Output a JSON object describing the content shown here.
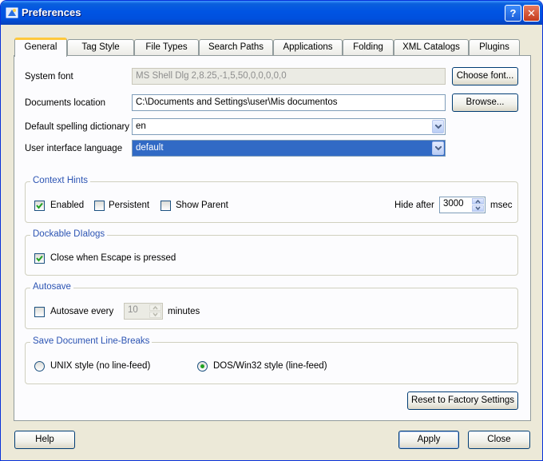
{
  "window": {
    "title": "Preferences",
    "help_glyph": "?",
    "close_glyph": "✕"
  },
  "tabs": [
    {
      "label": "General",
      "active": true
    },
    {
      "label": "Tag Style"
    },
    {
      "label": "File Types"
    },
    {
      "label": "Search Paths"
    },
    {
      "label": "Applications"
    },
    {
      "label": "Folding"
    },
    {
      "label": "XML Catalogs"
    },
    {
      "label": "Plugins"
    }
  ],
  "general": {
    "system_font_label": "System font",
    "system_font_value": "MS Shell Dlg 2,8.25,-1,5,50,0,0,0,0,0",
    "choose_font_label": "Choose font...",
    "documents_location_label": "Documents location",
    "documents_location_value": "C:\\Documents and Settings\\user\\Mis documentos",
    "browse_label": "Browse...",
    "spelling_label": "Default spelling dictionary",
    "spelling_value": "en",
    "ui_language_label": "User interface language",
    "ui_language_value": "default"
  },
  "context_hints": {
    "title": "Context Hints",
    "enabled_label": "Enabled",
    "enabled_checked": true,
    "persistent_label": "Persistent",
    "persistent_checked": false,
    "show_parent_label": "Show Parent",
    "show_parent_checked": false,
    "hide_after_label": "Hide after",
    "hide_after_value": "3000",
    "unit": "msec"
  },
  "dockable_dialogs": {
    "title": "Dockable DIalogs",
    "close_escape_label": "Close when Escape is pressed",
    "close_escape_checked": true
  },
  "autosave": {
    "title": "Autosave",
    "every_label": "Autosave every",
    "every_checked": false,
    "value": "10",
    "unit": "minutes"
  },
  "line_breaks": {
    "title": "Save Document Line-Breaks",
    "unix_label": "UNIX style (no line-feed)",
    "dos_label": "DOS/Win32 style (line-feed)",
    "selected": "dos"
  },
  "reset_label": "Reset to Factory Settings",
  "footer": {
    "help_label": "Help",
    "apply_label": "Apply",
    "close_label": "Close"
  },
  "colors": {
    "titlebar": "#0054e3",
    "accent_tab": "#ffc83c",
    "group_title": "#2c54b3",
    "selection": "#316ac5"
  }
}
